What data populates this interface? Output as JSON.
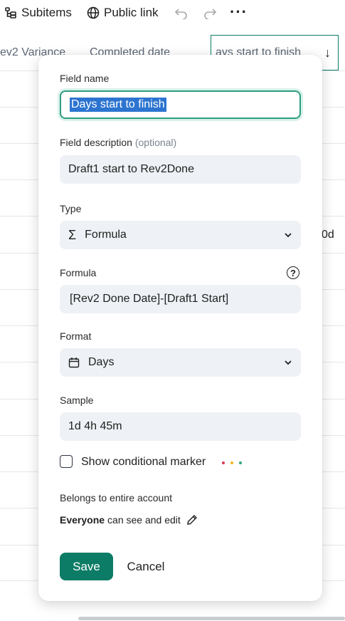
{
  "toolbar": {
    "subitems_label": "Subitems",
    "public_link_label": "Public link",
    "more_label": "···"
  },
  "grid": {
    "columns": [
      "ev2 Variance",
      "Completed date",
      "ays start to finish",
      ""
    ],
    "sort_arrow": "↓",
    "visible_cell": "0d"
  },
  "modal": {
    "field_name": {
      "label": "Field name",
      "value": "Days start to finish"
    },
    "field_description": {
      "label": "Field description",
      "optional": "(optional)",
      "value": "Draft1 start to Rev2Done"
    },
    "type": {
      "label": "Type",
      "value": "Formula",
      "icon": "sigma-icon"
    },
    "formula": {
      "label": "Formula",
      "help": "?",
      "value": "[Rev2 Done Date]-[Draft1 Start]"
    },
    "format": {
      "label": "Format",
      "value": "Days",
      "icon": "calendar-icon"
    },
    "sample": {
      "label": "Sample",
      "value": "1d 4h 45m"
    },
    "conditional_marker": {
      "label": "Show conditional marker",
      "checked": false,
      "dot_colors": [
        "#d83a52",
        "#f2b619",
        "#2fa77a"
      ]
    },
    "belongs": {
      "label": "Belongs to entire account",
      "who": "Everyone",
      "rest": "can see and edit"
    },
    "buttons": {
      "save": "Save",
      "cancel": "Cancel"
    }
  },
  "colors": {
    "accent": "#0d7c66",
    "selection": "#2c74d0",
    "field_bg": "#eef1f5"
  }
}
